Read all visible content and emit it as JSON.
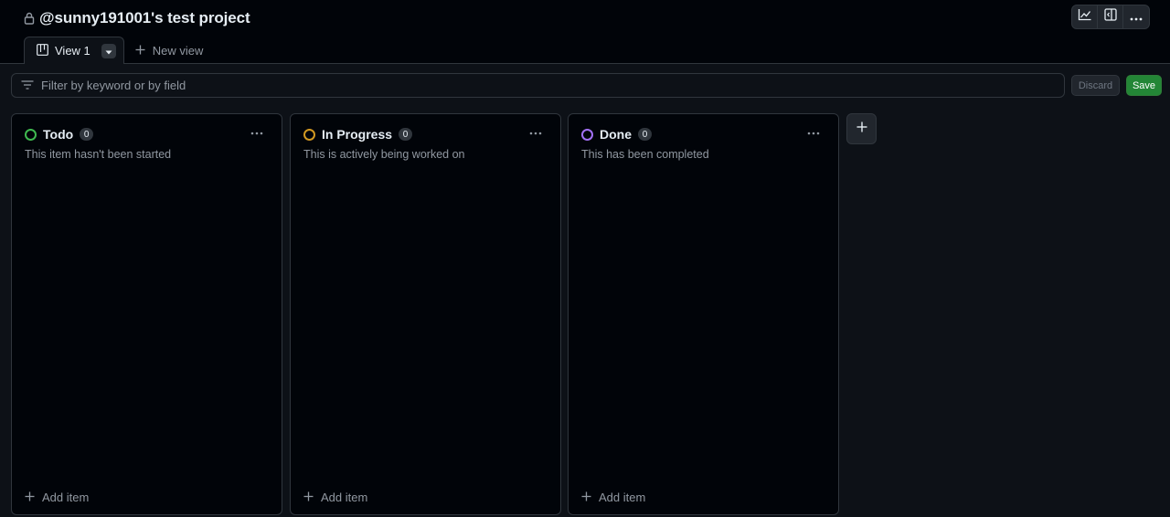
{
  "project": {
    "title": "@sunny191001's test project",
    "lock_icon": "lock-icon"
  },
  "toolbar": {
    "items": [
      "insights-chart-icon",
      "sidebar-layout-icon",
      "kebab-menu-icon"
    ]
  },
  "tabs": {
    "active_label": "View 1",
    "new_view_label": "New view"
  },
  "filter": {
    "placeholder": "Filter by keyword or by field",
    "value": ""
  },
  "actions": {
    "discard_label": "Discard",
    "save_label": "Save"
  },
  "columns": [
    {
      "name": "Todo",
      "count": "0",
      "description": "This item hasn't been started",
      "color": "#3fb950",
      "add_label": "Add item"
    },
    {
      "name": "In Progress",
      "count": "0",
      "description": "This is actively being worked on",
      "color": "#d29922",
      "add_label": "Add item"
    },
    {
      "name": "Done",
      "count": "0",
      "description": "This has been completed",
      "color": "#a371f7",
      "add_label": "Add item"
    }
  ],
  "colors": {
    "background": "#010409",
    "surface": "#0d1117",
    "border": "#30363d",
    "save_green": "#238636"
  }
}
